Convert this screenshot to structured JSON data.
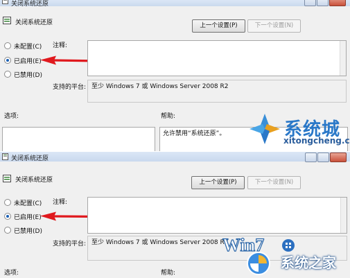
{
  "dialogs": [
    {
      "window_title": "关闭系统还原",
      "heading": "关闭系统还原",
      "prev_button": "上一个设置(P)",
      "next_button": "下一个设置(N)",
      "options": [
        {
          "label": "未配置(C)",
          "checked": false
        },
        {
          "label": "已启用(E)",
          "checked": true
        },
        {
          "label": "已禁用(D)",
          "checked": false
        }
      ],
      "comment_label": "注释:",
      "platform_label": "支持的平台:",
      "platform_value": "至少 Windows 7 或 Windows Server 2008 R2",
      "options_label": "选项:",
      "help_label": "帮助:",
      "help_text": "允许禁用“系统还原”。"
    },
    {
      "window_title": "关闭系统还原",
      "heading": "关闭系统还原",
      "prev_button": "上一个设置(P)",
      "next_button": "下一个设置(N)",
      "options": [
        {
          "label": "未配置(C)",
          "checked": false
        },
        {
          "label": "已启用(E)",
          "checked": true
        },
        {
          "label": "已禁用(D)",
          "checked": false
        }
      ],
      "comment_label": "注释:",
      "platform_label": "支持的平台:",
      "platform_value": "至少 Windows 7 或 Windows Server 2008 R2",
      "options_label": "选项:",
      "help_label": "帮助:"
    }
  ],
  "annotation": {
    "arrow_color": "#e0191e"
  },
  "watermarks": {
    "top_brand": "系统城",
    "top_url": "xitongcheng.com",
    "bottom_logo": "Win7",
    "bottom_brand": "系统之家"
  },
  "colors": {
    "dialog_bg": "#f0f0f0",
    "accent": "#1a5fb4"
  }
}
